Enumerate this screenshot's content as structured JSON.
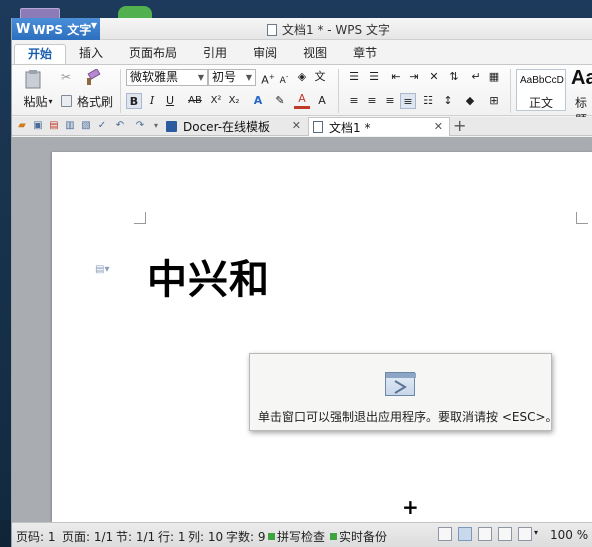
{
  "window": {
    "title": "文档1 * - WPS 文字"
  },
  "app_menu": {
    "label": "WPS 文字"
  },
  "ribbon_tabs": [
    "开始",
    "插入",
    "页面布局",
    "引用",
    "审阅",
    "视图",
    "章节"
  ],
  "ribbon": {
    "paste_label": "粘贴",
    "format_painter_label": "格式刷",
    "font_name": "微软雅黑",
    "font_size": "初号",
    "styles": [
      {
        "sample": "AaBbCcD",
        "name": "正文"
      },
      {
        "sample": "Aa",
        "name": "标题"
      }
    ]
  },
  "doc_tabs": [
    {
      "label": "Docer-在线模板",
      "active": false
    },
    {
      "label": "文档1 *",
      "active": true
    }
  ],
  "document": {
    "heading": "中兴和"
  },
  "dialog": {
    "message": "单击窗口可以强制退出应用程序。要取消请按 <ESC>。"
  },
  "statusbar": {
    "page_no": "页码: 1",
    "pages": "页面: 1/1",
    "section": "节: 1/1",
    "row": "行: 1",
    "col": "列: 10",
    "word_count": "字数: 9",
    "spell_check": "拼写检查",
    "backup": "实时备份",
    "zoom": "100 %"
  }
}
